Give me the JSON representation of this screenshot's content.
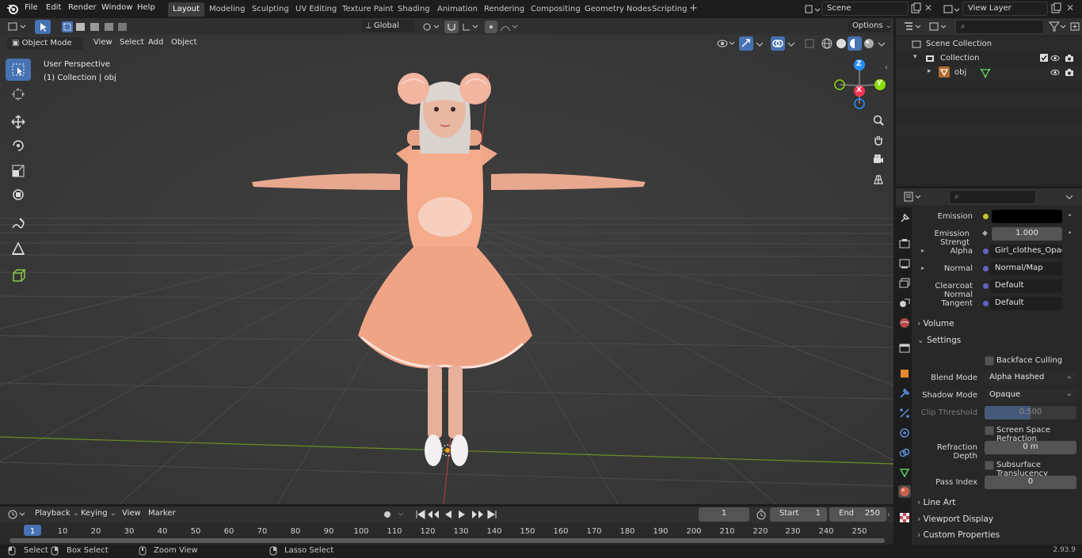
{
  "menu": {
    "file": "File",
    "edit": "Edit",
    "render": "Render",
    "window": "Window",
    "help": "Help"
  },
  "workspaces": [
    "Layout",
    "Modeling",
    "Sculpting",
    "UV Editing",
    "Texture Paint",
    "Shading",
    "Animation",
    "Rendering",
    "Compositing",
    "Geometry Nodes",
    "Scripting"
  ],
  "scene": {
    "name": "Scene",
    "view_layer": "View Layer"
  },
  "tool_header": {
    "orientation": "Global",
    "options": "Options"
  },
  "viewport": {
    "mode": "Object Mode",
    "menus": {
      "view": "View",
      "select": "Select",
      "add": "Add",
      "object": "Object"
    },
    "perspective": "User Perspective",
    "collection_info": "(1) Collection | obj",
    "gizmo": {
      "z": "Z",
      "y": "Y",
      "x": "X"
    }
  },
  "outliner": {
    "scene_collection": "Scene Collection",
    "collection": "Collection",
    "object": "obj"
  },
  "properties": {
    "emission": {
      "label": "Emission",
      "color": "#000000"
    },
    "emission_strength": {
      "label": "Emission Strengt",
      "value": "1.000"
    },
    "alpha": {
      "label": "Alpha",
      "value": "Girl_clothes_Opacity..."
    },
    "normal": {
      "label": "Normal",
      "value": "Normal/Map"
    },
    "clearcoat_normal": {
      "label": "Clearcoat Normal",
      "value": "Default"
    },
    "tangent": {
      "label": "Tangent",
      "value": "Default"
    },
    "volume": "Volume",
    "settings": "Settings",
    "backface_culling": "Backface Culling",
    "blend_mode": {
      "label": "Blend Mode",
      "value": "Alpha Hashed"
    },
    "shadow_mode": {
      "label": "Shadow Mode",
      "value": "Opaque"
    },
    "clip_threshold": {
      "label": "Clip Threshold",
      "value": "0.500"
    },
    "screen_space_refraction": "Screen Space Refraction",
    "refraction_depth": {
      "label": "Refraction Depth",
      "value": "0 m"
    },
    "subsurface_translucency": "Subsurface Translucency",
    "pass_index": {
      "label": "Pass Index",
      "value": "0"
    },
    "line_art": "Line Art",
    "viewport_display": "Viewport Display",
    "custom_properties": "Custom Properties"
  },
  "timeline": {
    "menus": {
      "playback": "Playback",
      "keying": "Keying",
      "view": "View",
      "marker": "Marker"
    },
    "current_frame": "1",
    "start_label": "Start",
    "start": "1",
    "end_label": "End",
    "end": "250",
    "ticks": [
      "1",
      "10",
      "20",
      "30",
      "40",
      "50",
      "60",
      "70",
      "80",
      "90",
      "100",
      "110",
      "120",
      "130",
      "140",
      "150",
      "160",
      "170",
      "180",
      "190",
      "200",
      "210",
      "220",
      "230",
      "240",
      "250"
    ]
  },
  "status": {
    "select": "Select",
    "box_select": "Box Select",
    "zoom_view": "Zoom View",
    "lasso_select": "Lasso Select",
    "version": "2.93.9"
  },
  "colors": {
    "accent": "#4772b3",
    "x_axis": "#ff3352",
    "y_axis": "#8bdc00",
    "z_axis": "#2890ff",
    "grid_green": "#6b8e23"
  }
}
